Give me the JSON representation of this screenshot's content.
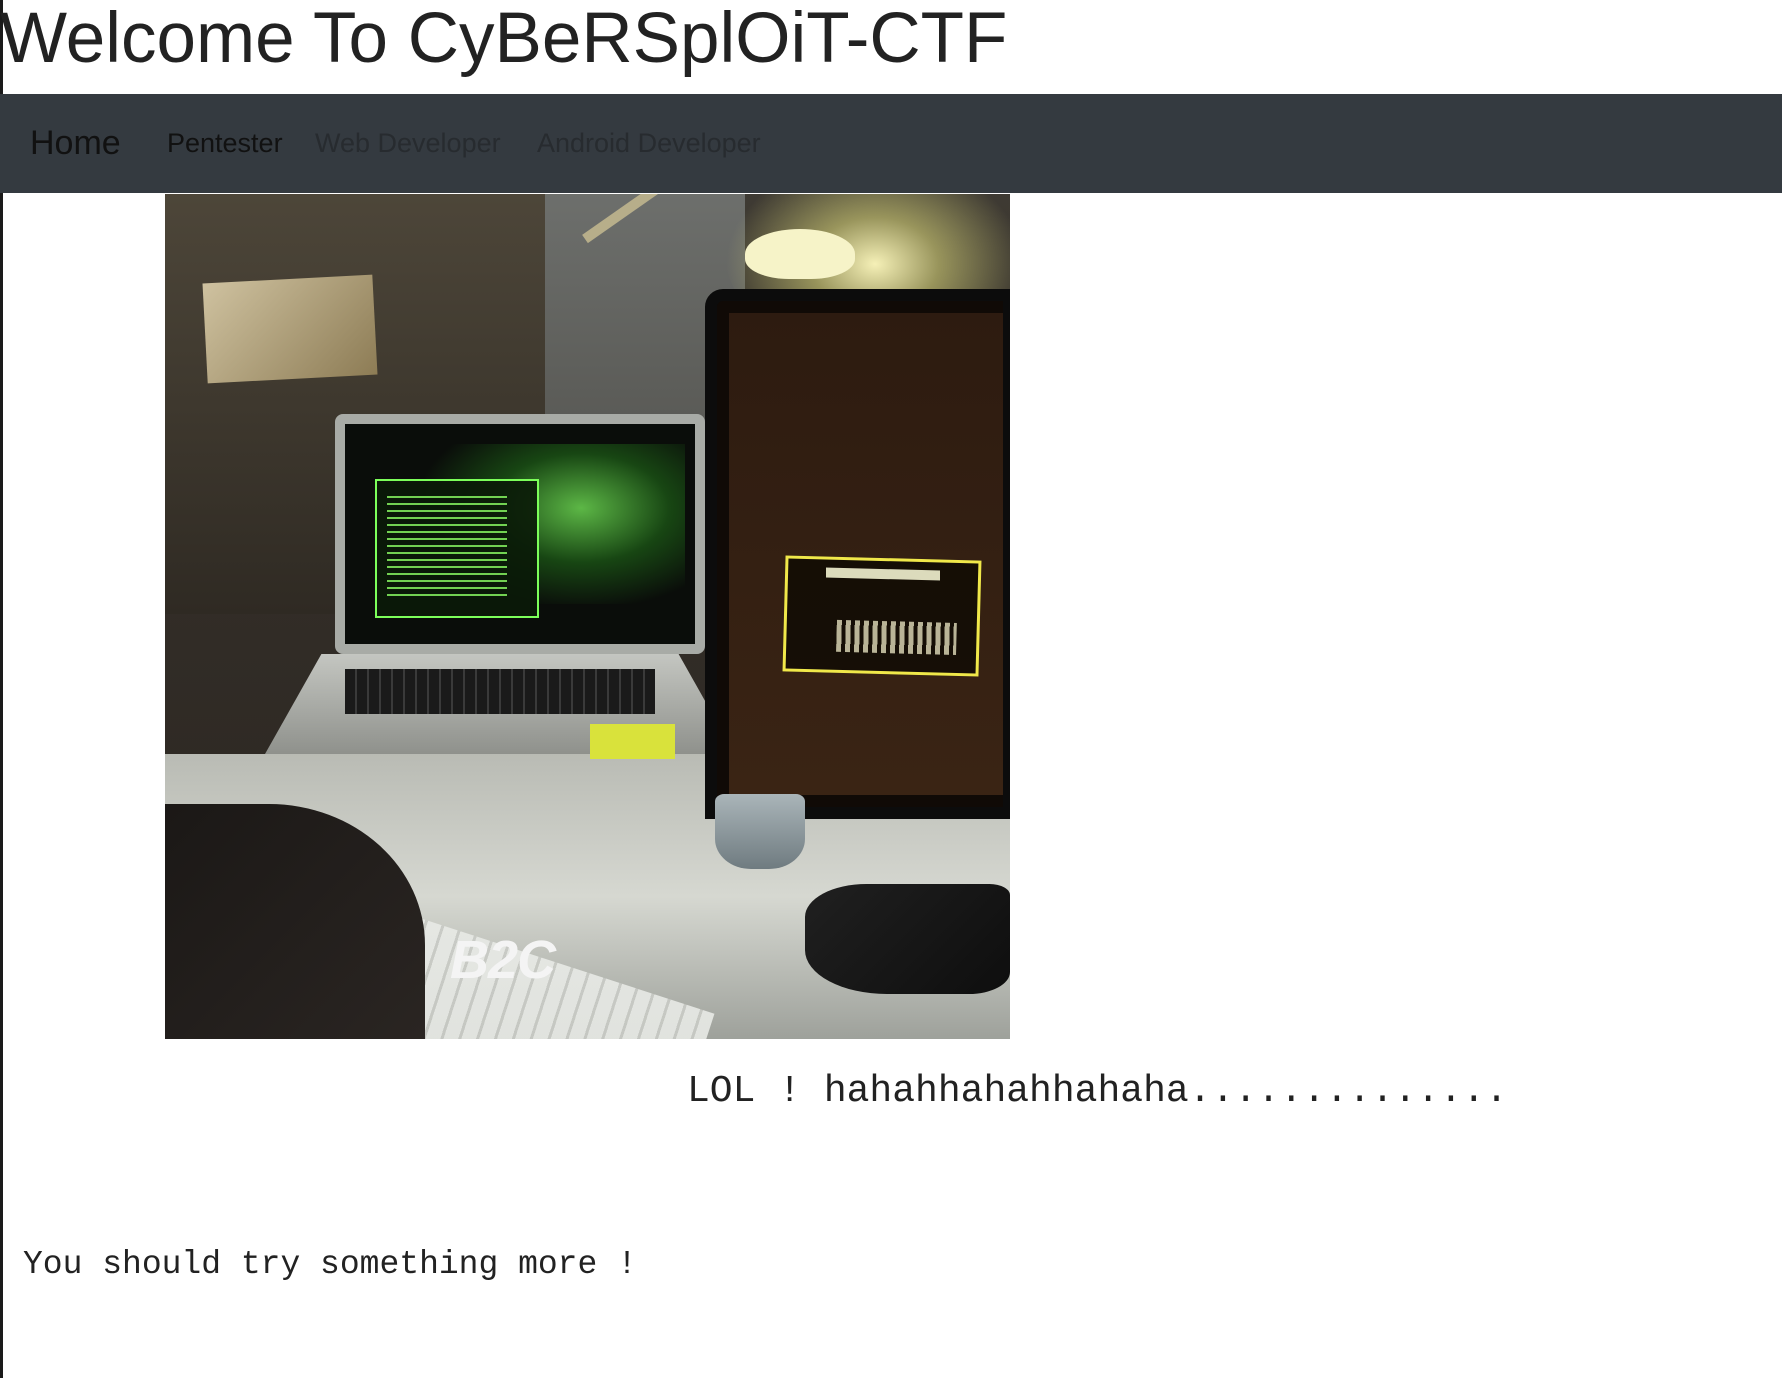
{
  "page": {
    "title": "Welcome To CyBeRSplOiT-CTF"
  },
  "navbar": {
    "items": [
      {
        "label": "Home"
      },
      {
        "label": "Pentester"
      },
      {
        "label": "Web Developer"
      },
      {
        "label": "Android Developer"
      }
    ],
    "background_color": "#343a40"
  },
  "hero_image": {
    "watermark": "B2C"
  },
  "content": {
    "lol": "LOL ! hahahhahahhahaha..............",
    "hint": "You should try something more !"
  }
}
